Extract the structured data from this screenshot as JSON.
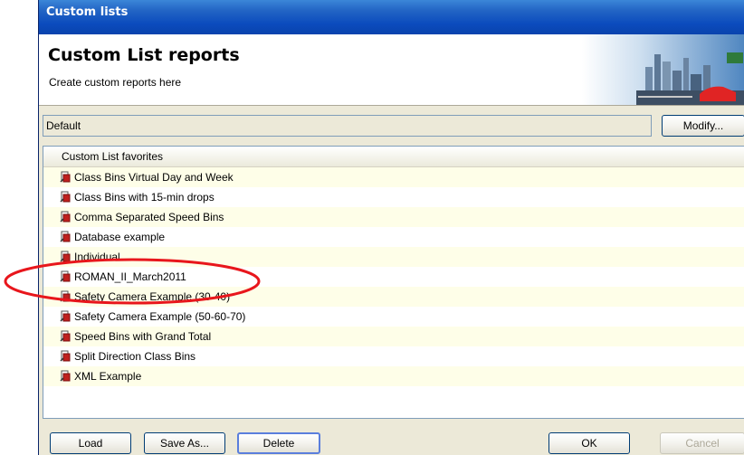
{
  "window": {
    "title": "Custom lists"
  },
  "header": {
    "title": "Custom List reports",
    "subtitle": "Create custom reports here"
  },
  "preset": {
    "value": "Default",
    "modify_label": "Modify..."
  },
  "list": {
    "column_header": "Custom List favorites",
    "items": [
      "Class Bins Virtual Day and Week",
      "Class Bins with 15-min drops",
      "Comma Separated Speed Bins",
      "Database example",
      "Individual",
      "ROMAN_II_March2011",
      "Safety Camera Example (30-40)",
      "Safety Camera Example (50-60-70)",
      "Speed Bins with Grand Total",
      "Split Direction Class Bins",
      "XML Example"
    ],
    "highlighted_item": "ROMAN_II_March2011"
  },
  "buttons": {
    "load": "Load",
    "save_as": "Save As...",
    "delete": "Delete",
    "ok": "OK",
    "cancel": "Cancel"
  },
  "colors": {
    "annotation": "#e8161c",
    "titlebar": "#0b4bbd",
    "row_alt": "#fefee8"
  }
}
